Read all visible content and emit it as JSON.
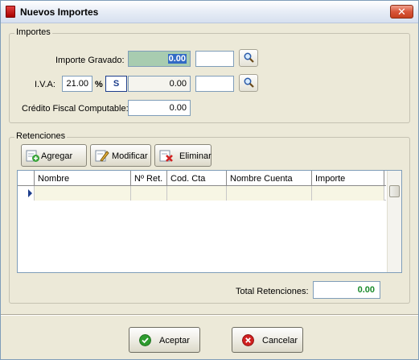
{
  "window": {
    "title": "Nuevos Importes",
    "close_glyph": "✕"
  },
  "importes": {
    "legend": "Importes",
    "gravado_label": "Importe Gravado:",
    "gravado_value": "0.00",
    "iva_label": "I.V.A:",
    "iva_rate": "21.00",
    "iva_percent": "%",
    "iva_code": "S",
    "iva_value": "0.00",
    "credito_label": "Crédito Fiscal Computable:",
    "credito_value": "0.00"
  },
  "retenciones": {
    "legend": "Retenciones",
    "buttons": {
      "agregar": "Agregar",
      "modificar": "Modificar",
      "eliminar": "Eliminar"
    },
    "columns": [
      "Nombre",
      "Nº Ret.",
      "Cod. Cta",
      "Nombre Cuenta",
      "Importe"
    ],
    "total_label": "Total Retenciones:",
    "total_value": "0.00"
  },
  "footer": {
    "accept": "Aceptar",
    "cancel": "Cancelar"
  },
  "icons": {
    "title": "app-icon",
    "search": "magnifier-icon",
    "add": "add-icon",
    "edit": "edit-icon",
    "delete": "delete-icon",
    "accept": "check-circle-icon",
    "cancel": "cancel-circle-icon"
  },
  "colors": {
    "total": "#198a2a",
    "active_field": "#a8ccb0",
    "accept": "#2e9b2e",
    "cancel": "#d02020"
  }
}
